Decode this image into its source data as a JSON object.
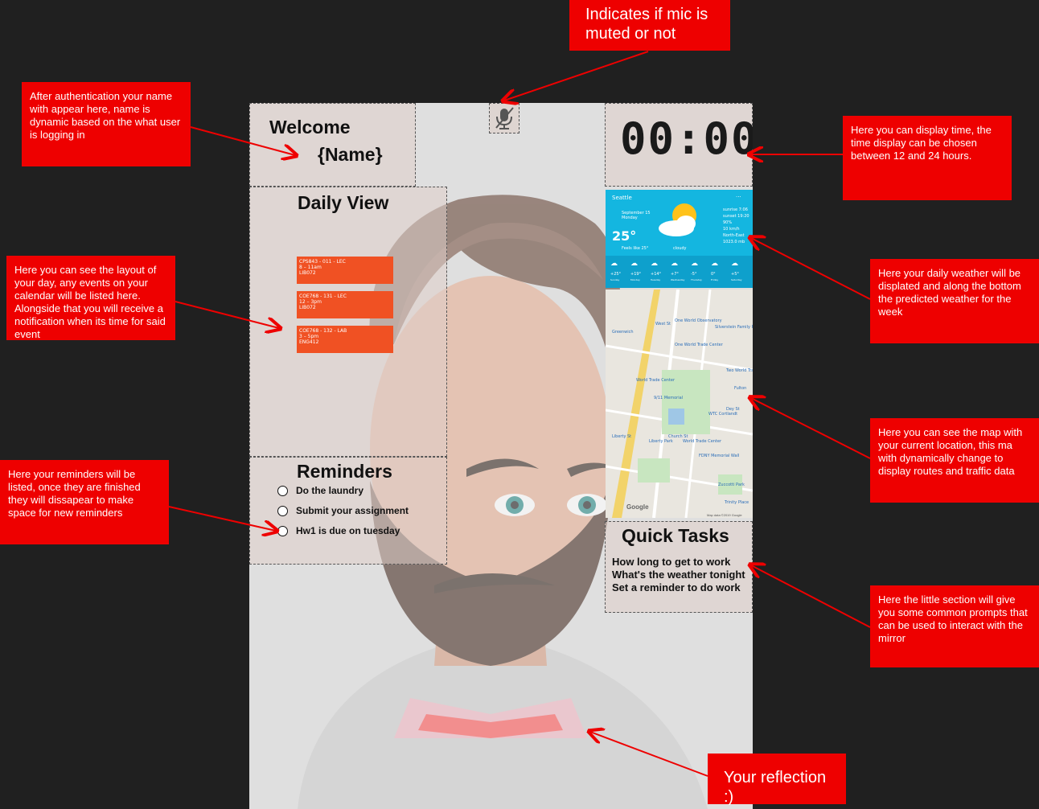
{
  "mic": {
    "icon": "mic-muted-icon"
  },
  "welcome": {
    "title": "Welcome",
    "name": "{Name}"
  },
  "clock": {
    "time": "00:00"
  },
  "daily_view": {
    "title": "Daily View",
    "events": [
      {
        "code": "CPS843 - 011 - LEC",
        "time": "8 – 11am",
        "room": "LIB072"
      },
      {
        "code": "COE768 - 131 - LEC",
        "time": "12 – 3pm",
        "room": "LIB072"
      },
      {
        "code": "COE768 - 132 - LAB",
        "time": "3 – 5pm",
        "room": "ENG412"
      }
    ]
  },
  "reminders": {
    "title": "Reminders",
    "items": [
      "Do the laundry",
      "Submit your assignment",
      "Hw1 is due on tuesday"
    ]
  },
  "weather": {
    "city": "Seattle",
    "date": "September 15",
    "day": "Monday",
    "temp": "25°",
    "feels": "Feels like 25°",
    "condition": "cloudy",
    "details": [
      "sunrise 7:06",
      "sunset 19:20",
      "90%",
      "10 km/h",
      "North-East",
      "1023.0 mb"
    ],
    "forecast": [
      {
        "t": "+25°",
        "d": "Sunday"
      },
      {
        "t": "+19°",
        "d": "Monday"
      },
      {
        "t": "+14°",
        "d": "Tuesday"
      },
      {
        "t": "+7°",
        "d": "Wednesday"
      },
      {
        "t": "-5°",
        "d": "Thursday"
      },
      {
        "t": "0°",
        "d": "Friday"
      },
      {
        "t": "+5°",
        "d": "Saturday"
      }
    ]
  },
  "map": {
    "labels": [
      "One World Observatory",
      "One World Trade Center",
      "World Trade Center",
      "9/11 Memorial",
      "WTC Cortlandt",
      "Liberty Park",
      "World Trade Center",
      "FDNY Memorial Wall",
      "Silverstein Family Park",
      "Zuccotti Park",
      "Trinity Place",
      "Two World Trade",
      "Fulton",
      "West St",
      "Church St",
      "Cedar St",
      "Greenwich",
      "Dey St",
      "Liberty St"
    ],
    "google": "Google",
    "credit": "Map data ©2019 Google"
  },
  "quick_tasks": {
    "title": "Quick Tasks",
    "items": [
      "How long to get to work",
      "What's the weather tonight",
      "Set a reminder to do work"
    ]
  },
  "notes": {
    "mic": "Indicates if mic is muted or not",
    "name": "After authentication your name with appear here, name is dynamic based on the what user is logging in",
    "time": "Here you can display time, the time display can be chosen between 12 and 24 hours.",
    "daily": "Here you can see the layout of your day, any events on your calendar will be listed here. Alongside that you will receive a notification when its time for said event",
    "weather": "Here your daily weather will be displated and along the bottom the predicted weather for the week",
    "map": "Here you can see the map with your current location, this ma with dynamically change to display routes and traffic data",
    "reminders": "Here your reminders will be listed, once they are finished they will dissapear to make space for new reminders",
    "tasks": "Here the little section will give you some common prompts that can be used to interact with the mirror",
    "reflection": "Your reflection :)"
  },
  "colors": {
    "annotation": "#ee0000",
    "event": "#f05123",
    "weather_bg": "#14b6e0",
    "background": "#202020"
  }
}
